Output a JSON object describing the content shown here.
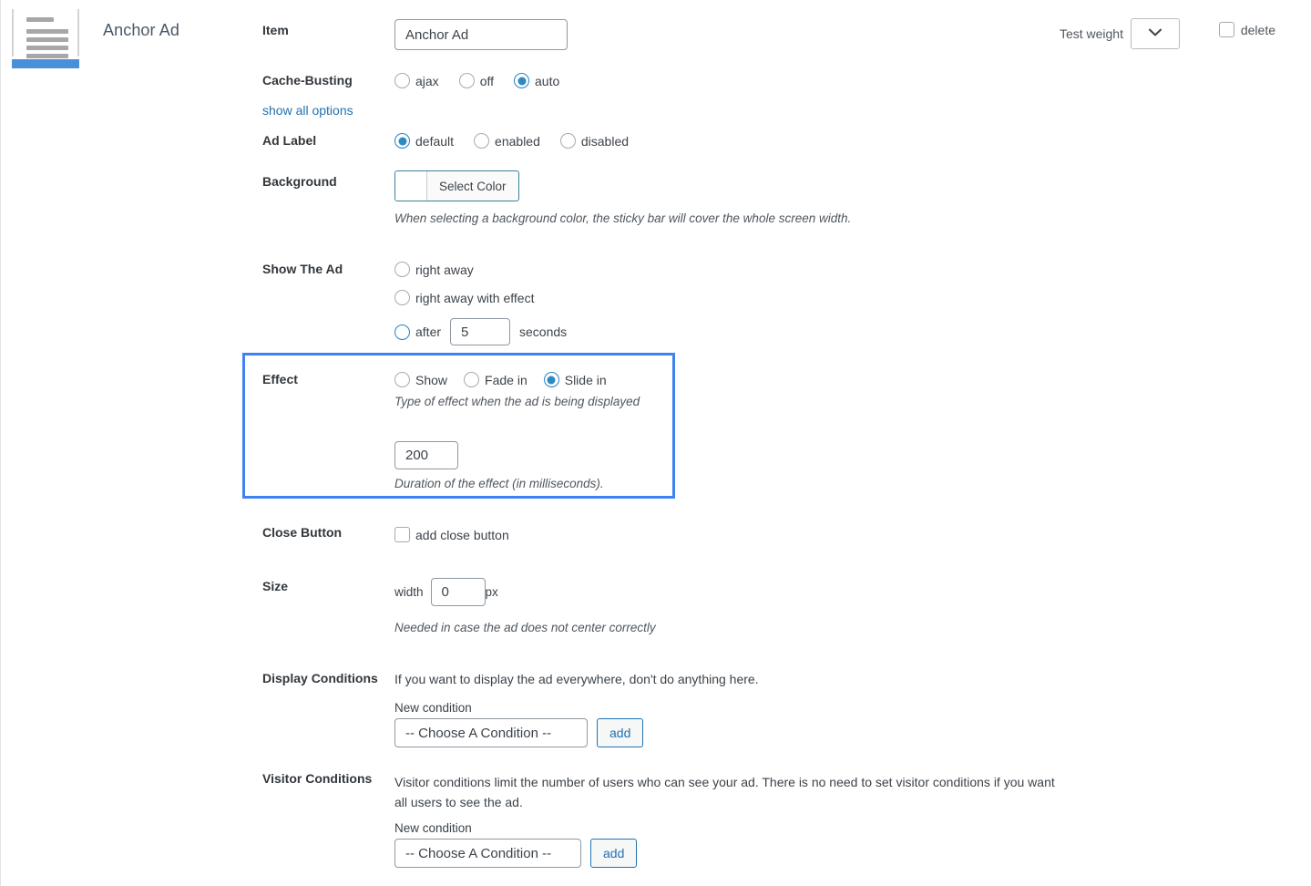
{
  "header": {
    "icon_name": "anchor-ad-icon",
    "title": "Anchor Ad",
    "test_weight_label": "Test weight",
    "test_weight_value": "",
    "delete_label": "delete"
  },
  "fields": {
    "item": {
      "label": "Item",
      "value": "Anchor Ad"
    },
    "cache_busting": {
      "label": "Cache-Busting",
      "options": [
        {
          "label": "ajax",
          "selected": false
        },
        {
          "label": "off",
          "selected": false
        },
        {
          "label": "auto",
          "selected": true
        }
      ],
      "show_all_options": "show all options"
    },
    "ad_label": {
      "label": "Ad Label",
      "options": [
        {
          "label": "default",
          "selected": true
        },
        {
          "label": "enabled",
          "selected": false
        },
        {
          "label": "disabled",
          "selected": false
        }
      ]
    },
    "background": {
      "label": "Background",
      "button_label": "Select Color",
      "description": "When selecting a background color, the sticky bar will cover the whole screen width."
    },
    "show_the_ad": {
      "label": "Show The Ad",
      "options": [
        {
          "label": "right away",
          "selected": false
        },
        {
          "label": "right away with effect",
          "selected": false
        },
        {
          "label": "after",
          "selected": true
        }
      ],
      "seconds_value": "5",
      "seconds_suffix": "seconds"
    },
    "effect": {
      "label": "Effect",
      "options": [
        {
          "label": "Show",
          "selected": false
        },
        {
          "label": "Fade in",
          "selected": false
        },
        {
          "label": "Slide in",
          "selected": true
        }
      ],
      "description": "Type of effect when the ad is being displayed",
      "duration_value": "200",
      "duration_description": "Duration of the effect (in milliseconds)."
    },
    "close_button": {
      "label": "Close Button",
      "checkbox_label": "add close button",
      "checked": false
    },
    "size": {
      "label": "Size",
      "width_prefix": "width",
      "width_value": "0",
      "unit": "px",
      "description": "Needed in case the ad does not center correctly"
    },
    "display_conditions": {
      "label": "Display Conditions",
      "description": "If you want to display the ad everywhere, don't do anything here.",
      "new_condition_label": "New condition",
      "select_value": "-- Choose A Condition --",
      "add_label": "add"
    },
    "visitor_conditions": {
      "label": "Visitor Conditions",
      "description": "Visitor conditions limit the number of users who can see your ad. There is no need to set visitor conditions if you want all users to see the ad.",
      "new_condition_label": "New condition",
      "select_value": "-- Choose A Condition --",
      "add_label": "add"
    }
  },
  "colors": {
    "accent_blue": "#2c8ac0",
    "highlight_border": "#3f83f0",
    "link_blue": "#2271b1",
    "icon_bar_blue": "#4a90d9"
  }
}
